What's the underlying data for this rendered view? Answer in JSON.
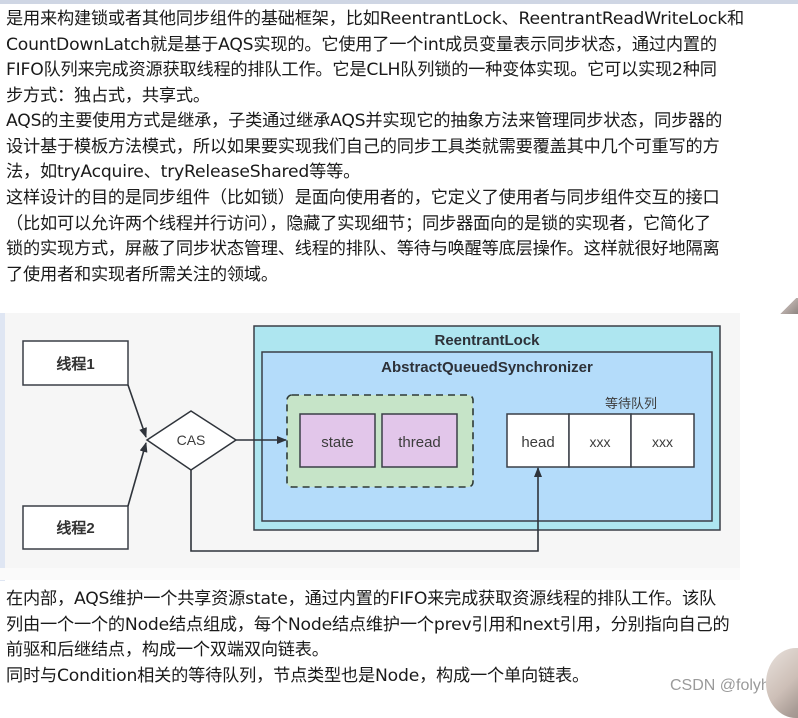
{
  "paragraphs": {
    "p1": [
      "是用来构建锁或者其他同步组件的基础框架，比如ReentrantLock、ReentrantReadWriteLock和",
      "CountDownLatch就是基于AQS实现的。它使用了一个int成员变量表示同步状态，通过内置的",
      "FIFO队列来完成资源获取线程的排队工作。它是CLH队列锁的一种变体实现。它可以实现2种同",
      "步方式：独占式，共享式。"
    ],
    "p2": [
      "AQS的主要使用方式是继承，子类通过继承AQS并实现它的抽象方法来管理同步状态，同步器的",
      "设计基于模板方法模式，所以如果要实现我们自己的同步工具类就需要覆盖其中几个可重写的方",
      "法，如tryAcquire、tryReleaseShared等等。"
    ],
    "p3": [
      "这样设计的目的是同步组件（比如锁）是面向使用者的，它定义了使用者与同步组件交互的接口",
      "（比如可以允许两个线程并行访问），隐藏了实现细节；同步器面向的是锁的实现者，它简化了",
      "锁的实现方式，屏蔽了同步状态管理、线程的排队、等待与唤醒等底层操作。这样就很好地隔离",
      "了使用者和实现者所需关注的领域。"
    ],
    "p4": [
      "在内部，AQS维护一个共享资源state，通过内置的FIFO来完成获取资源线程的排队工作。该队",
      "列由一个一个的Node结点组成，每个Node结点维护一个prev引用和next引用，分别指向自己的",
      "前驱和后继结点，构成一个双端双向链表。",
      "同时与Condition相关的等待队列，节点类型也是Node，构成一个单向链表。"
    ]
  },
  "diagram": {
    "thread1": "线程1",
    "thread2": "线程2",
    "cas": "CAS",
    "outer_title": "ReentrantLock",
    "inner_title": "AbstractQueuedSynchronizer",
    "state": "state",
    "thread": "thread",
    "queue_label": "等待队列",
    "queue_cells": [
      "head",
      "xxx",
      "xxx"
    ],
    "colors": {
      "outer_fill": "#aee6f0",
      "inner_fill": "#b4dcfa",
      "group_fill": "#c6e4c8",
      "field_fill": "#e2c6ea",
      "stroke": "#3a3f47"
    }
  },
  "watermark": "CSDN @folyh"
}
